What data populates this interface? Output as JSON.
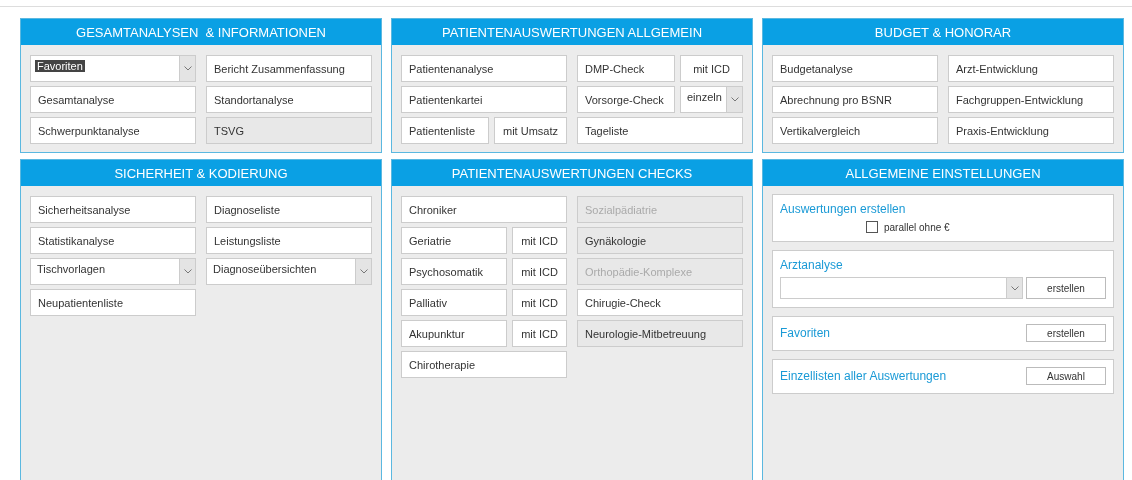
{
  "panels": [
    {
      "title": "GESAMTANALYSEN  & INFORMATIONEN",
      "columns": [
        [
          {
            "kind": "select",
            "value": "Favoriten",
            "highlighted": true
          },
          {
            "kind": "button",
            "label": "Gesamtanalyse",
            "shaded": false,
            "disabled": false
          },
          {
            "kind": "button",
            "label": "Schwerpunktanalyse",
            "shaded": false,
            "disabled": false
          }
        ],
        [
          {
            "kind": "button",
            "label": "Bericht Zusammenfassung",
            "shaded": false,
            "disabled": false
          },
          {
            "kind": "button",
            "label": "Standortanalyse",
            "shaded": false,
            "disabled": false
          },
          {
            "kind": "button",
            "label": "TSVG",
            "shaded": true,
            "disabled": false
          }
        ]
      ]
    },
    {
      "title": "PATIENTENAUSWERTUNGEN ALLGEMEIN",
      "columns": [
        [
          {
            "kind": "button",
            "label": "Patientenanalyse",
            "shaded": false,
            "disabled": false
          },
          {
            "kind": "button",
            "label": "Patientenkartei",
            "shaded": false,
            "disabled": false
          },
          {
            "kind": "pair",
            "label": "Patientenliste",
            "side": {
              "kind": "button",
              "label": "mit Umsatz"
            }
          }
        ],
        [
          {
            "kind": "pair",
            "label": "DMP-Check",
            "side": {
              "kind": "button",
              "label": "mit ICD"
            }
          },
          {
            "kind": "pair",
            "label": "Vorsorge-Check",
            "side": {
              "kind": "select",
              "value": "einzeln"
            }
          },
          {
            "kind": "button",
            "label": "Tageliste",
            "shaded": false,
            "disabled": false
          }
        ]
      ]
    },
    {
      "title": "BUDGET & HONORAR",
      "columns": [
        [
          {
            "kind": "button",
            "label": "Budgetanalyse",
            "shaded": false,
            "disabled": false
          },
          {
            "kind": "button",
            "label": "Abrechnung pro BSNR",
            "shaded": false,
            "disabled": false
          },
          {
            "kind": "button",
            "label": "Vertikalvergleich",
            "shaded": false,
            "disabled": false
          }
        ],
        [
          {
            "kind": "button",
            "label": "Arzt-Entwicklung",
            "shaded": false,
            "disabled": false
          },
          {
            "kind": "button",
            "label": "Fachgruppen-Entwicklung",
            "shaded": false,
            "disabled": false
          },
          {
            "kind": "button",
            "label": "Praxis-Entwicklung",
            "shaded": false,
            "disabled": false
          }
        ]
      ]
    },
    {
      "title": "SICHERHEIT & KODIERUNG",
      "columns": [
        [
          {
            "kind": "button",
            "label": "Sicherheitsanalyse",
            "shaded": false,
            "disabled": false
          },
          {
            "kind": "button",
            "label": "Statistikanalyse",
            "shaded": false,
            "disabled": false
          },
          {
            "kind": "select",
            "value": "Tischvorlagen",
            "highlighted": false
          },
          {
            "kind": "button",
            "label": "Neupatientenliste",
            "shaded": false,
            "disabled": false
          }
        ],
        [
          {
            "kind": "button",
            "label": "Diagnoseliste",
            "shaded": false,
            "disabled": false
          },
          {
            "kind": "button",
            "label": "Leistungsliste",
            "shaded": false,
            "disabled": false
          },
          {
            "kind": "select",
            "value": "Diagnoseübersichten",
            "highlighted": false
          }
        ]
      ]
    },
    {
      "title": "PATIENTENAUSWERTUNGEN CHECKS",
      "columns": [
        [
          {
            "kind": "button",
            "label": "Chroniker",
            "shaded": false,
            "disabled": false
          },
          {
            "kind": "pair",
            "label": "Geriatrie",
            "side": {
              "kind": "button",
              "label": "mit ICD"
            }
          },
          {
            "kind": "pair",
            "label": "Psychosomatik",
            "side": {
              "kind": "button",
              "label": "mit ICD"
            }
          },
          {
            "kind": "pair",
            "label": "Palliativ",
            "side": {
              "kind": "button",
              "label": "mit ICD"
            }
          },
          {
            "kind": "pair",
            "label": "Akupunktur",
            "side": {
              "kind": "button",
              "label": "mit ICD"
            }
          },
          {
            "kind": "button",
            "label": "Chirotherapie",
            "shaded": false,
            "disabled": false
          }
        ],
        [
          {
            "kind": "button",
            "label": "Sozialpädiatrie",
            "shaded": true,
            "disabled": true
          },
          {
            "kind": "button",
            "label": "Gynäkologie",
            "shaded": true,
            "disabled": false
          },
          {
            "kind": "button",
            "label": "Orthopädie-Komplexe",
            "shaded": true,
            "disabled": true
          },
          {
            "kind": "button",
            "label": "Chirugie-Check",
            "shaded": false,
            "disabled": false
          },
          {
            "kind": "button",
            "label": "Neurologie-Mitbetreuung",
            "shaded": true,
            "disabled": false
          }
        ]
      ]
    },
    {
      "title": "ALLGEMEINE EINSTELLUNGEN",
      "sections": [
        {
          "kind": "checkbox",
          "title": "Auswertungen erstellen",
          "checkbox": {
            "label": "parallel ohne €",
            "checked": false
          }
        },
        {
          "kind": "select-action",
          "title": "Arztanalyse",
          "button": "erstellen"
        },
        {
          "kind": "action",
          "title": "Favoriten",
          "button": "erstellen"
        },
        {
          "kind": "action",
          "title": "Einzellisten aller Auswertungen",
          "button": "Auswahl"
        }
      ]
    }
  ]
}
